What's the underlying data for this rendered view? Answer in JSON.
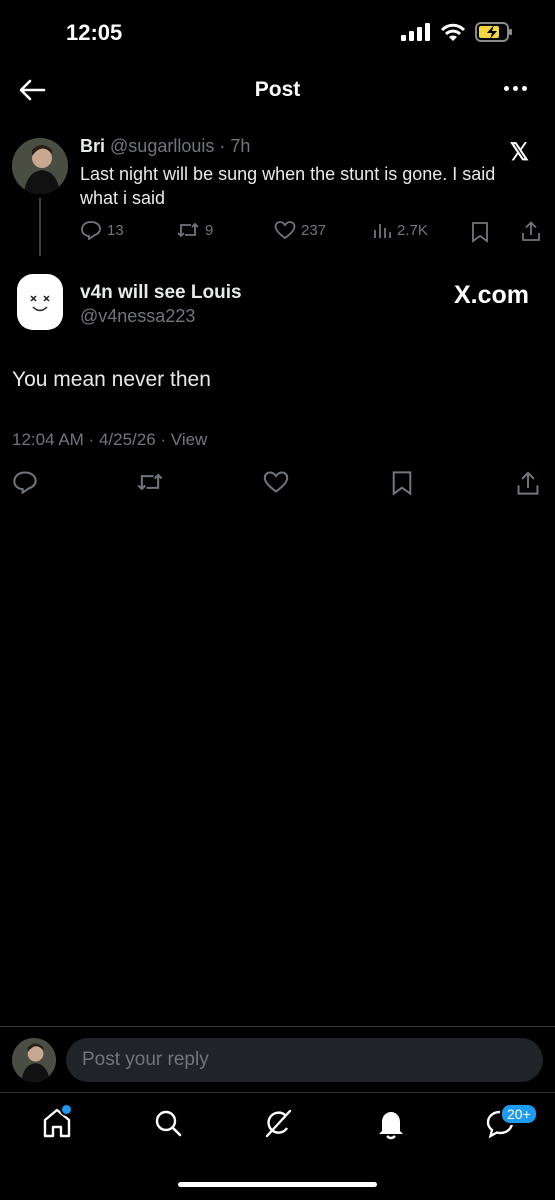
{
  "status_bar": {
    "time": "12:05"
  },
  "header": {
    "title": "Post"
  },
  "parent_post": {
    "name": "Bri",
    "handle": "@sugarllouis",
    "time": "7h",
    "text": "Last night will be sung when the stunt is gone. I said what i said",
    "replies": "13",
    "reposts": "9",
    "likes": "237",
    "views": "2.7K"
  },
  "post": {
    "name": "v4n will see Louis",
    "handle": "@v4nessa223",
    "watermark": "X.com",
    "text": "You mean never then",
    "timestamp": "12:04 AM",
    "date": "4/25/26",
    "view_label": "View"
  },
  "composer": {
    "placeholder": "Post your reply"
  },
  "nav": {
    "messages_badge": "20+"
  },
  "colors": {
    "background": "#000000",
    "accent": "#1d9bf0",
    "muted": "#71767b"
  }
}
